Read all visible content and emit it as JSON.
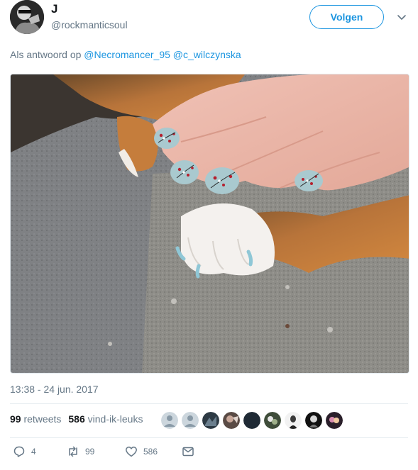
{
  "user": {
    "name": "J",
    "handle": "@rockmanticsoul"
  },
  "follow_label": "Volgen",
  "reply": {
    "prefix": "Als antwoord op",
    "mention_1": "@Necromancer_95",
    "mention_2": "@c_wilczynska"
  },
  "timestamp": "13:38 - 24 jun. 2017",
  "stats": {
    "retweets_count": "99",
    "retweets_label": "retweets",
    "likes_count": "586",
    "likes_label": "vind-ik-leuks"
  },
  "actions": {
    "reply_count": "4",
    "retweet_count": "99",
    "like_count": "586"
  },
  "colors": {
    "accent": "#1b95e0",
    "muted": "#657786",
    "text": "#14171a",
    "divider": "#e6ecf0"
  },
  "icons": [
    "chevron-down-icon",
    "reply-icon",
    "retweet-icon",
    "like-icon",
    "message-icon"
  ]
}
